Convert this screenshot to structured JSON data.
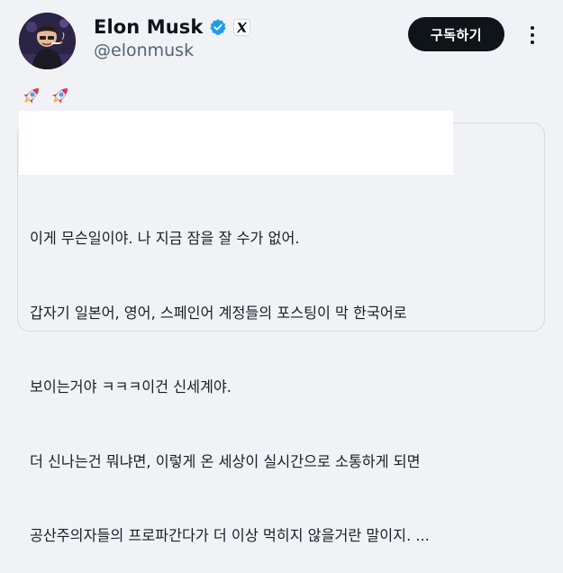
{
  "author": {
    "display_name": "Elon Musk",
    "handle": "@elonmusk",
    "verified_icon": "verified-badge-icon",
    "affiliate_icon": "x-logo-icon",
    "avatar": "profile-avatar"
  },
  "actions": {
    "subscribe_label": "구독하기",
    "more_icon": "more-options-icon"
  },
  "post": {
    "emojis": [
      "rocket-emoji",
      "rocket-emoji"
    ],
    "redacted_block": "white-redaction"
  },
  "quote": {
    "lines": [
      "이게 무슨일이야. 나 지금 잠을 잘 수가 없어.",
      "갑자기 일본어, 영어, 스페인어 계정들의 포스팅이 막 한국어로",
      "보이는거야 ㅋㅋㅋ이건 신세계야.",
      "더 신나는건 뭐냐면, 이렇게 온 세상이 실시간으로 소통하게 되면",
      "공산주의자들의 프로파간다가 더 이상 먹히지 않을거란 말이지. ..."
    ]
  },
  "colors": {
    "background": "#f0f2f5",
    "button": "#0f1419",
    "verified": "#1d9bf0",
    "handle_text": "#536471"
  }
}
